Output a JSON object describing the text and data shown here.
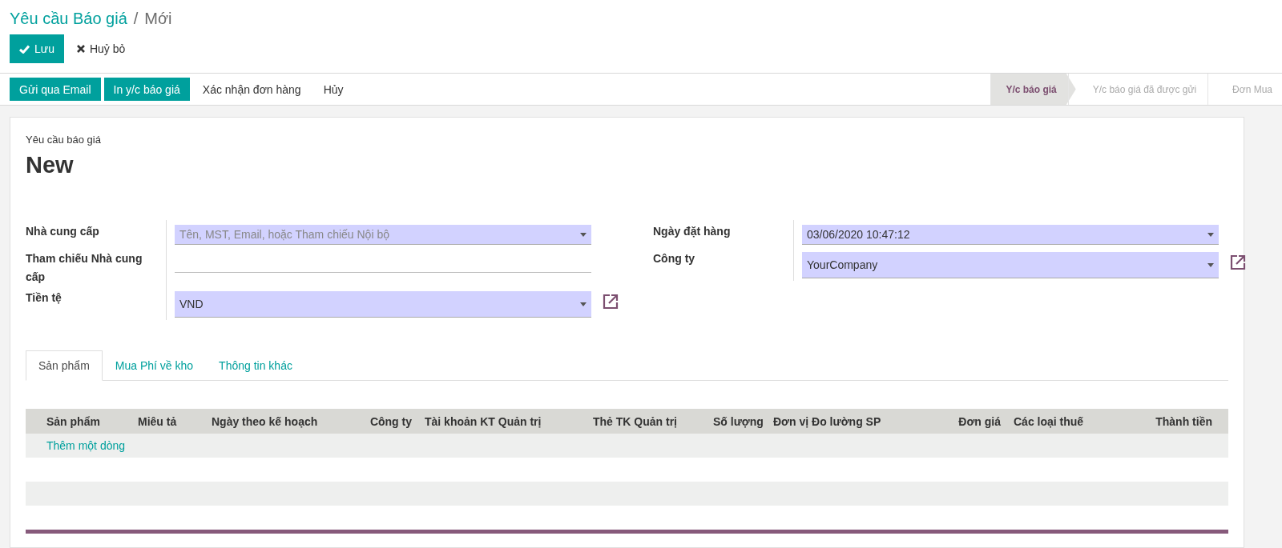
{
  "breadcrumb": {
    "parent": "Yêu cầu Báo giá",
    "separator": "/",
    "current": "Mới"
  },
  "control_buttons": [
    {
      "label": "Lưu",
      "kind": "primary"
    },
    {
      "label": "Huỷ bỏ",
      "kind": "link"
    }
  ],
  "action_buttons": [
    {
      "label": "Gửi qua Email",
      "kind": "primary"
    },
    {
      "label": "In y/c báo giá",
      "kind": "primary"
    },
    {
      "label": "Xác nhận đơn hàng",
      "kind": "link"
    },
    {
      "label": "Hủy",
      "kind": "link"
    }
  ],
  "status_steps": [
    {
      "label": "Y/c báo giá",
      "selected": true
    },
    {
      "label": "Y/c báo giá đã được gửi",
      "selected": false
    },
    {
      "label": "Đơn Mua",
      "selected": false
    }
  ],
  "sheet": {
    "subtitle": "Yêu cầu báo giá",
    "title": "New"
  },
  "left_fields": [
    {
      "label": "Nhà cung cấp",
      "kind": "dropdown",
      "placeholder": "Tên, MST, Email, hoặc Tham chiếu Nội bộ",
      "external_link": false
    },
    {
      "label": "Tham chiếu Nhà cung cấp",
      "kind": "text",
      "external_link": false
    },
    {
      "label": "Tiền tệ",
      "kind": "dropdown",
      "value": "VND",
      "external_link": true
    }
  ],
  "right_fields": [
    {
      "label": "Ngày đặt hàng",
      "kind": "dropdown",
      "value": "03/06/2020 10:47:12",
      "external_link": false
    },
    {
      "label": "Công ty",
      "kind": "dropdown",
      "value": "YourCompany",
      "external_link": true
    }
  ],
  "tabs": [
    {
      "label": "Sản phẩm",
      "selected": true
    },
    {
      "label": "Mua Phí về kho",
      "selected": false
    },
    {
      "label": "Thông tin khác",
      "selected": false
    }
  ],
  "table": {
    "columns": [
      {
        "label": "Sản phẩm"
      },
      {
        "label": "Miêu tả"
      },
      {
        "label": "Ngày theo kế hoạch"
      },
      {
        "label": "Công ty"
      },
      {
        "label": "Tài khoản KT Quản trị"
      },
      {
        "label": "Thẻ TK Quản trị"
      },
      {
        "label": "Số lượng"
      },
      {
        "label": "Đơn vị Đo lường SP"
      },
      {
        "label": "Đơn giá"
      },
      {
        "label": "Các loại thuế"
      },
      {
        "label": "Thành tiền"
      }
    ],
    "add_line": "Thêm một dòng"
  }
}
